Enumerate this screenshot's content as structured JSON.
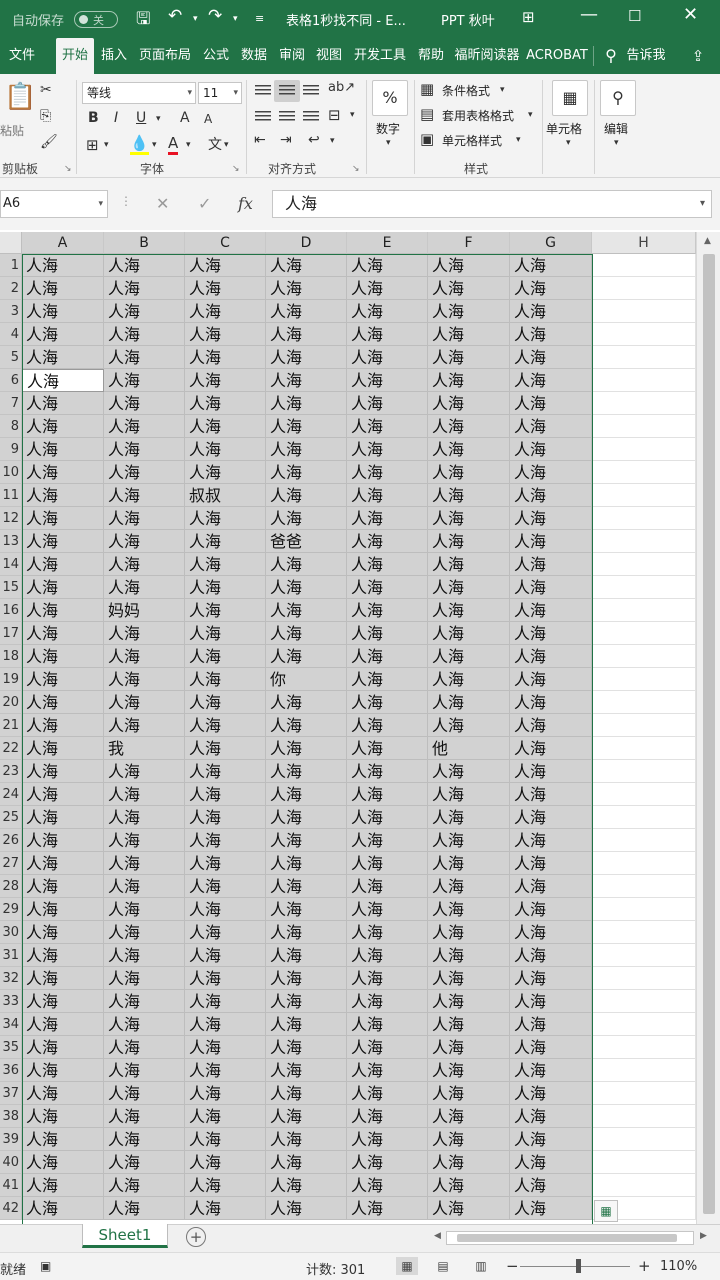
{
  "titlebar": {
    "autosave_label": "自动保存",
    "autosave_state": "关",
    "doc_title": "表格1秒找不同 - E...",
    "user_name": "PPT 秋叶"
  },
  "tabs": [
    "文件",
    "开始",
    "插入",
    "页面布局",
    "公式",
    "数据",
    "审阅",
    "视图",
    "开发工具",
    "帮助",
    "福昕阅读器",
    "ACROBAT"
  ],
  "tell_me": "告诉我",
  "ribbon": {
    "paste": "粘贴",
    "clipboard_label": "剪贴板",
    "font_name": "等线",
    "font_size": "11",
    "bold": "B",
    "italic": "I",
    "underline": "U",
    "grow_font": "A",
    "shrink_font": "A",
    "font_color_letter": "A",
    "wen": "文",
    "font_label": "字体",
    "align_label": "对齐方式",
    "number_label": "数字",
    "conditional_format": "条件格式",
    "table_format": "套用表格格式",
    "cell_style": "单元格样式",
    "styles_label": "样式",
    "cells_label": "单元格",
    "edit_label": "编辑"
  },
  "formula_bar": {
    "name_box": "A6",
    "fx": "fx",
    "formula": "人海"
  },
  "columns": [
    "A",
    "B",
    "C",
    "D",
    "E",
    "F",
    "G",
    "H"
  ],
  "sheet": {
    "default_value": "人海",
    "row_numbers": [
      "1",
      "2",
      "3",
      "4",
      "5",
      "6",
      "7",
      "8",
      "9",
      "10",
      "11",
      "12",
      "13",
      "14",
      "15",
      "16",
      "17",
      "18",
      "19",
      "20",
      "21",
      "22",
      "23",
      "24",
      "25",
      "26",
      "27",
      "28",
      "29",
      "30",
      "31",
      "32",
      "33",
      "34",
      "35",
      "36",
      "37",
      "38",
      "39",
      "40",
      "41",
      "42"
    ],
    "active_cell": {
      "row": 6,
      "col": "A"
    },
    "differences": [
      {
        "row": 11,
        "col": "C",
        "value": "叔叔"
      },
      {
        "row": 13,
        "col": "D",
        "value": "爸爸"
      },
      {
        "row": 16,
        "col": "B",
        "value": "妈妈"
      },
      {
        "row": 19,
        "col": "D",
        "value": "你"
      },
      {
        "row": 22,
        "col": "B",
        "value": "我"
      },
      {
        "row": 22,
        "col": "F",
        "value": "他"
      }
    ]
  },
  "sheet_tab": "Sheet1",
  "status": {
    "ready": "就绪",
    "count": "计数: 301",
    "zoom": "110%"
  },
  "colors": {
    "accent": "#217346",
    "selection_fill": "#d2d2d2"
  }
}
